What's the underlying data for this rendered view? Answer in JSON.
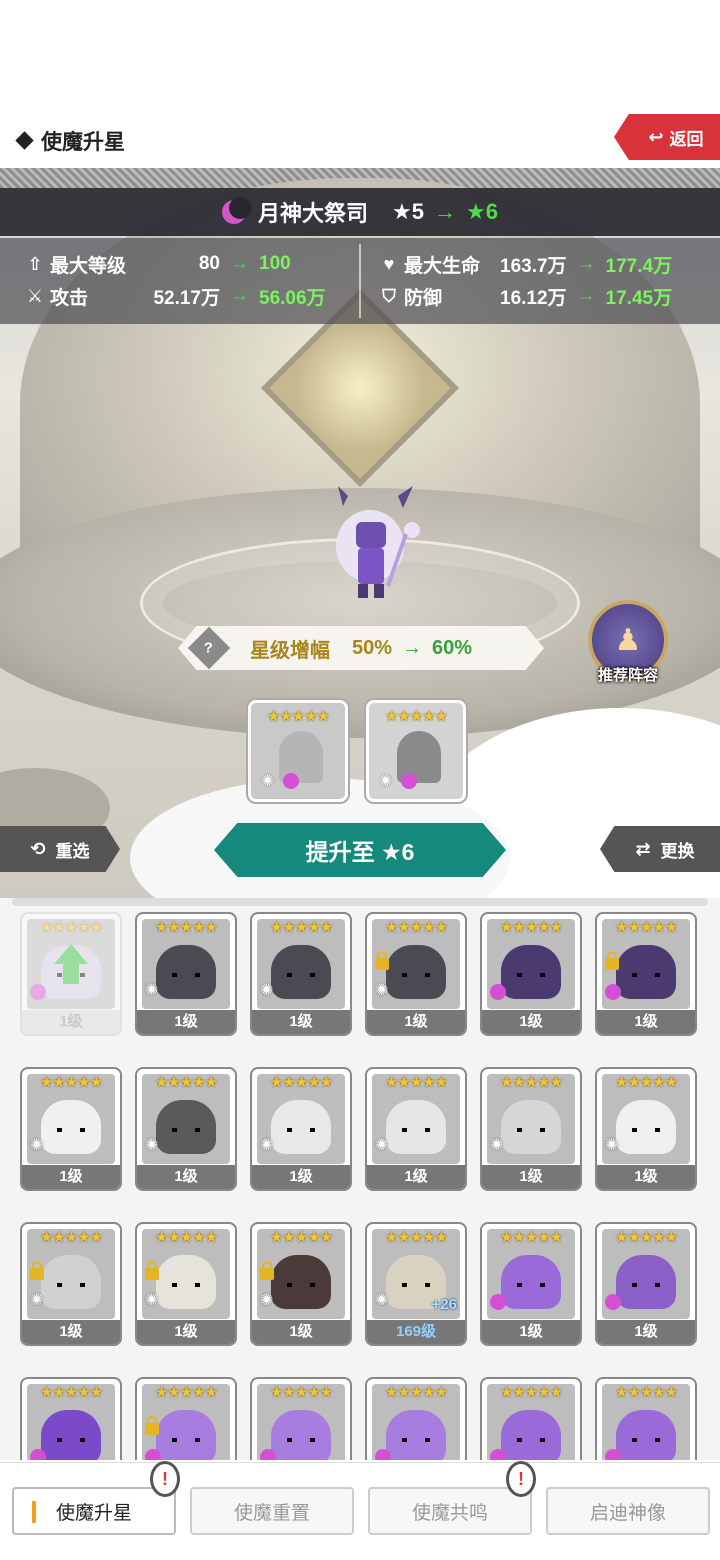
{
  "header": {
    "title": "使魔升星",
    "back_label": "返回"
  },
  "banner": {
    "name": "月神大祭司",
    "star_from": "★5",
    "star_to": "★6"
  },
  "stats": [
    {
      "icon": "level-up-arrow-icon",
      "label": "最大等级",
      "old": "80",
      "new": "100"
    },
    {
      "icon": "attack-icon",
      "label": "攻击",
      "old": "52.17万",
      "new": "56.06万"
    },
    {
      "icon": "heart-icon",
      "label": "最大生命",
      "old": "163.7万",
      "new": "177.4万"
    },
    {
      "icon": "shield-icon",
      "label": "防御",
      "old": "16.12万",
      "new": "17.45万"
    }
  ],
  "boost": {
    "label": "星级增幅",
    "old": "50%",
    "new": "60%"
  },
  "recommend": {
    "label": "推荐阵容"
  },
  "materials": [
    {
      "stars": "★★★★★",
      "filled": true
    },
    {
      "stars": "★★★★★",
      "filled": false
    }
  ],
  "actions": {
    "reselect": "重选",
    "upgrade": "提升至 ★6",
    "swap": "更换"
  },
  "grid": [
    {
      "stars": "★★★★★",
      "level": "1级",
      "element": "moon",
      "lock": false,
      "color": "#d9cfe6",
      "faded": true,
      "upgrade": true
    },
    {
      "stars": "★★★★★",
      "level": "1级",
      "element": "sun",
      "lock": false,
      "color": "#4a4a52"
    },
    {
      "stars": "★★★★★",
      "level": "1级",
      "element": "sun",
      "lock": false,
      "color": "#4a4a52"
    },
    {
      "stars": "★★★★★",
      "level": "1级",
      "element": "sun",
      "lock": true,
      "color": "#4a4a52"
    },
    {
      "stars": "★★★★★",
      "level": "1级",
      "element": "moon",
      "lock": false,
      "color": "#4a3a70"
    },
    {
      "stars": "★★★★★",
      "level": "1级",
      "element": "moon",
      "lock": true,
      "color": "#4a3a70"
    },
    {
      "stars": "★★★★★",
      "level": "1级",
      "element": "sun",
      "lock": false,
      "color": "#f0f0f0"
    },
    {
      "stars": "★★★★★",
      "level": "1级",
      "element": "sun",
      "lock": false,
      "color": "#5a5a5a"
    },
    {
      "stars": "★★★★★",
      "level": "1级",
      "element": "sun",
      "lock": false,
      "color": "#e8e8e8"
    },
    {
      "stars": "★★★★★",
      "level": "1级",
      "element": "sun",
      "lock": false,
      "color": "#e6e6e6"
    },
    {
      "stars": "★★★★★",
      "level": "1级",
      "element": "sun",
      "lock": false,
      "color": "#d6d6d6"
    },
    {
      "stars": "★★★★★",
      "level": "1级",
      "element": "sun",
      "lock": false,
      "color": "#efefef"
    },
    {
      "stars": "★★★★★",
      "level": "1级",
      "element": "sun",
      "lock": true,
      "color": "#d0d0d0"
    },
    {
      "stars": "★★★★★",
      "level": "1级",
      "element": "sun",
      "lock": true,
      "color": "#e6e3da"
    },
    {
      "stars": "★★★★★",
      "level": "1级",
      "element": "sun",
      "lock": true,
      "color": "#4a3a3a"
    },
    {
      "stars": "★★★★★",
      "level": "169级",
      "element": "sun",
      "lock": false,
      "color": "#d9d2c0",
      "bonus": "+26",
      "blue": true
    },
    {
      "stars": "★★★★★",
      "level": "1级",
      "element": "moon",
      "lock": false,
      "color": "#9a6ad8"
    },
    {
      "stars": "★★★★★",
      "level": "1级",
      "element": "moon",
      "lock": false,
      "color": "#8a60c8"
    },
    {
      "stars": "★★★★★",
      "level": "",
      "element": "moon",
      "lock": false,
      "color": "#7a4ac8"
    },
    {
      "stars": "★★★★★",
      "level": "",
      "element": "moon",
      "lock": true,
      "color": "#a77de0"
    },
    {
      "stars": "★★★★★",
      "level": "",
      "element": "moon",
      "lock": false,
      "color": "#a77de0"
    },
    {
      "stars": "★★★★★",
      "level": "",
      "element": "moon",
      "lock": false,
      "color": "#a77de0"
    },
    {
      "stars": "★★★★★",
      "level": "",
      "element": "moon",
      "lock": false,
      "color": "#9a6ad8"
    },
    {
      "stars": "★★★★★",
      "level": "",
      "element": "moon",
      "lock": false,
      "color": "#9a6ad8"
    }
  ],
  "tabs": [
    {
      "label": "使魔升星",
      "active": true,
      "alert": true
    },
    {
      "label": "使魔重置",
      "active": false,
      "alert": false
    },
    {
      "label": "使魔共鸣",
      "active": false,
      "alert": true
    },
    {
      "label": "启迪神像",
      "active": false,
      "alert": false
    }
  ]
}
